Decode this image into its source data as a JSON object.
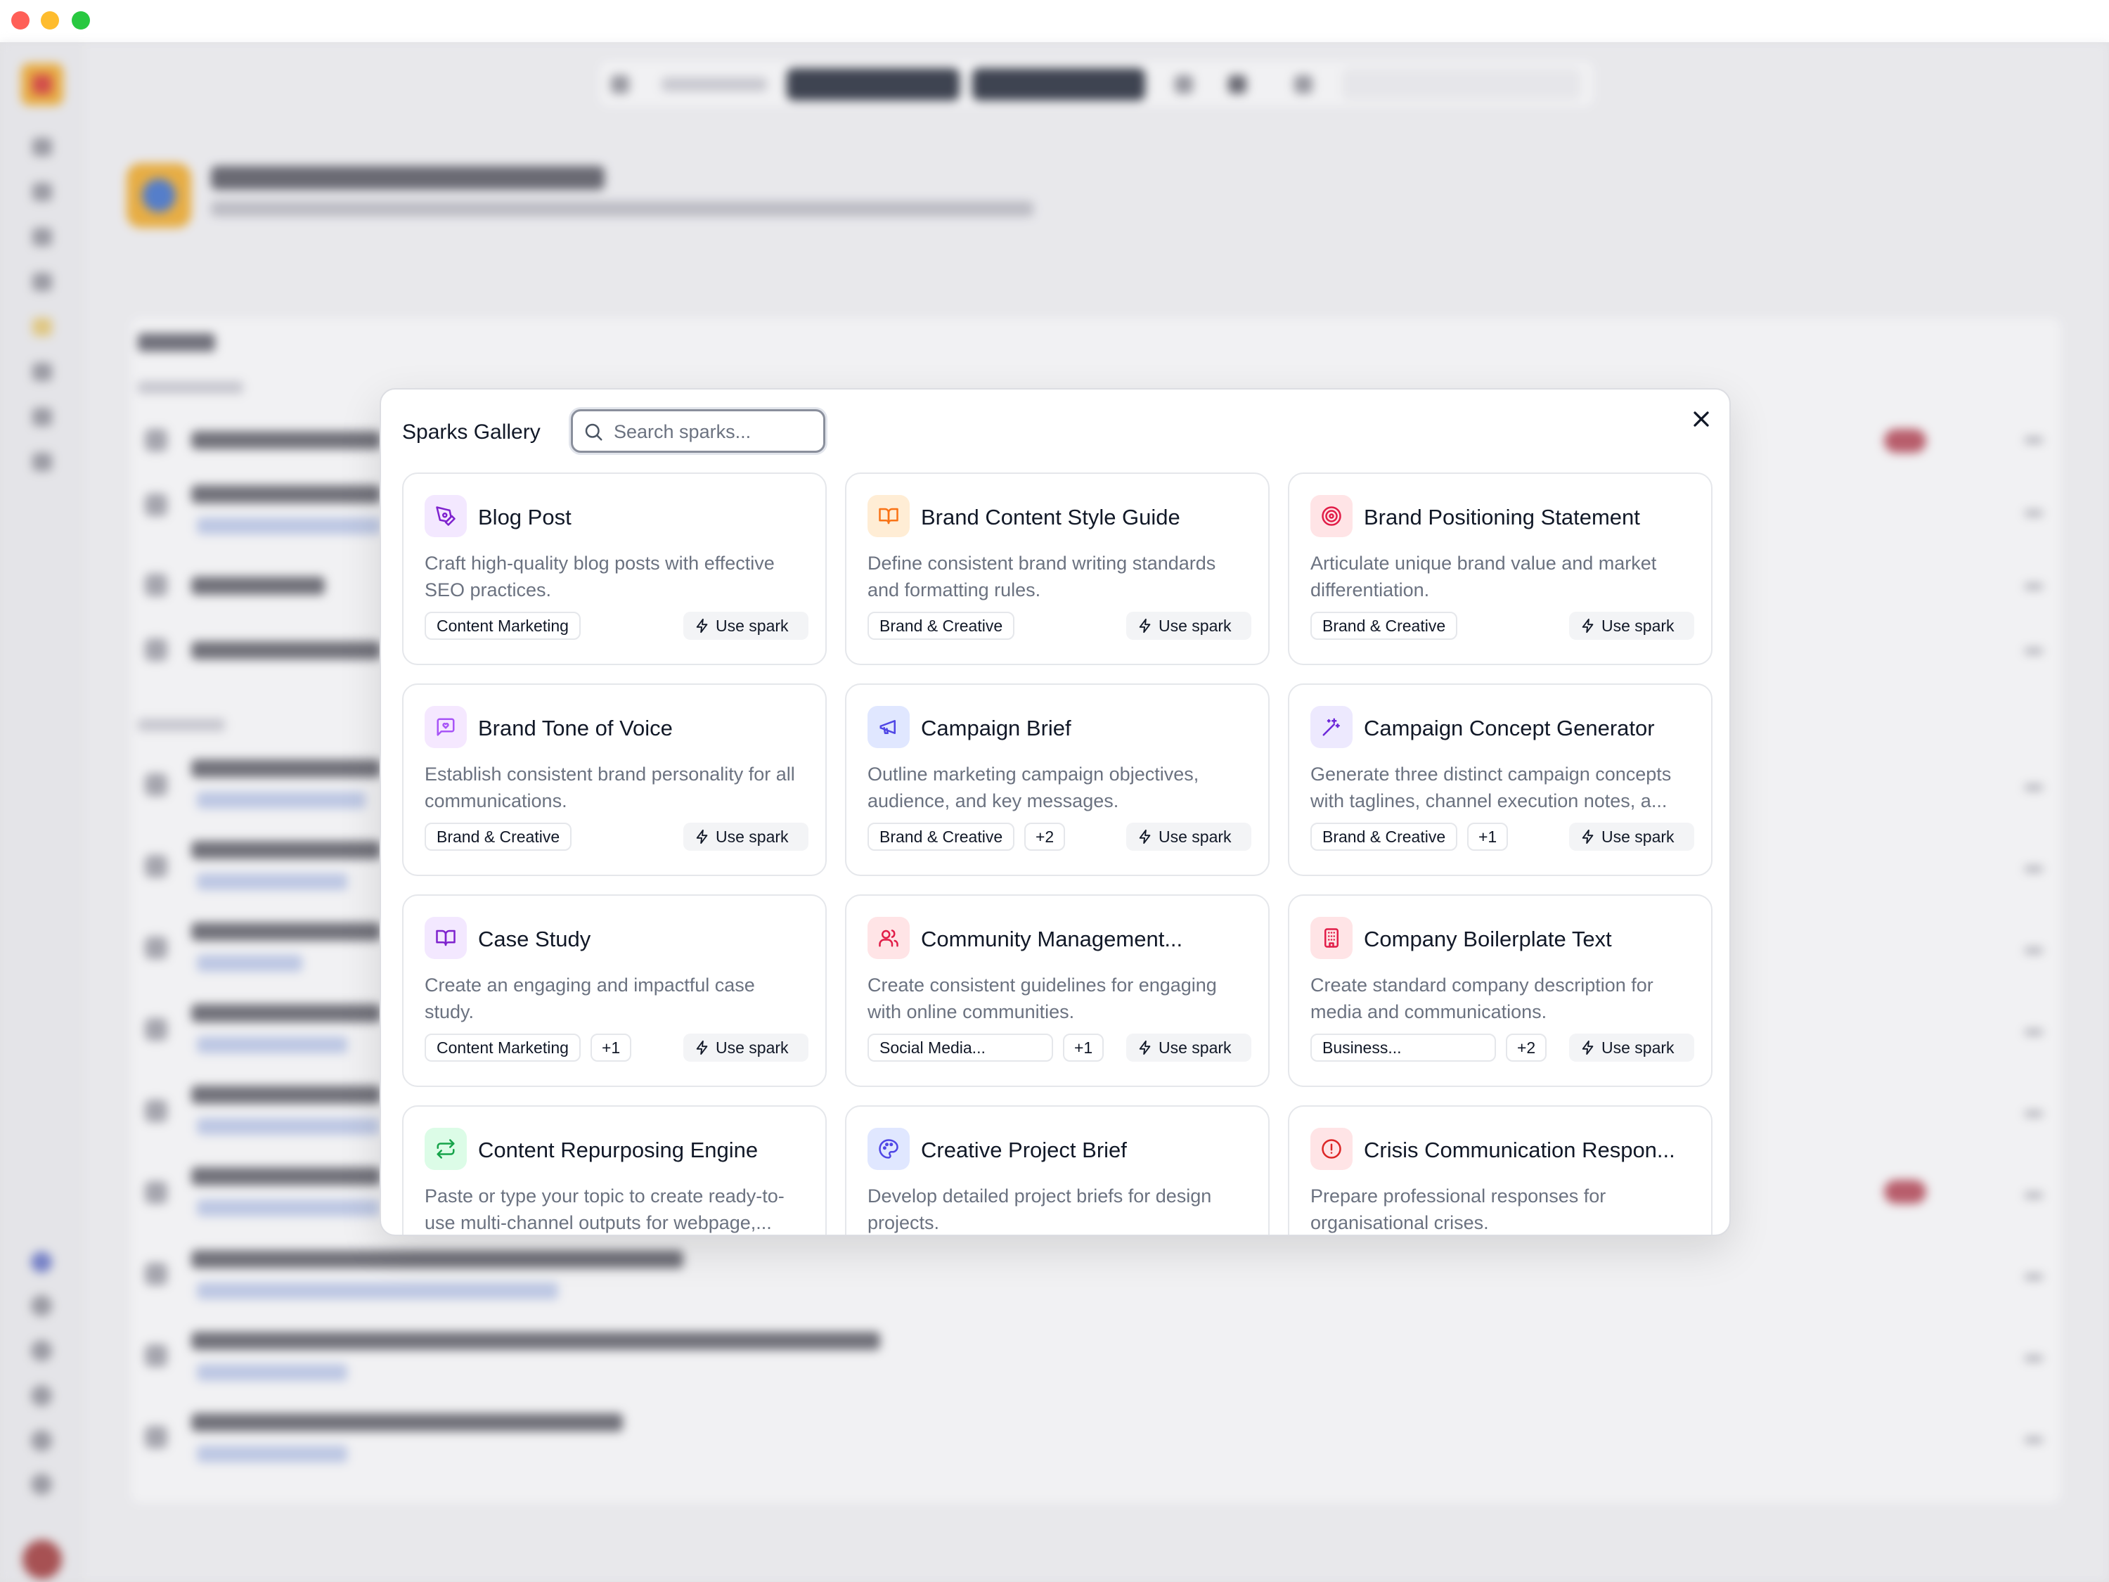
{
  "window": {
    "traffic_lights": [
      "#ff5f57",
      "#febc2e",
      "#28c840"
    ]
  },
  "modal": {
    "title": "Sparks Gallery",
    "search_placeholder": "Search sparks...",
    "close_icon": "close-icon"
  },
  "cards": [
    {
      "title": "Blog Post",
      "description": "Craft high-quality blog posts with effective SEO practices.",
      "tag": "Content Marketing",
      "more": "",
      "action": "Use spark",
      "icon": "pen-tool-icon",
      "icon_bg": "#f3e8ff",
      "icon_color": "#7e22ce"
    },
    {
      "title": "Brand Content Style Guide",
      "description": "Define consistent brand writing standards and formatting rules.",
      "tag": "Brand & Creative",
      "more": "",
      "action": "Use spark",
      "icon": "book-open-icon",
      "icon_bg": "#ffedd5",
      "icon_color": "#f97316"
    },
    {
      "title": "Brand Positioning Statement",
      "description": "Articulate unique brand value and market differentiation.",
      "tag": "Brand & Creative",
      "more": "",
      "action": "Use spark",
      "icon": "target-icon",
      "icon_bg": "#ffe4e6",
      "icon_color": "#e11d48"
    },
    {
      "title": "Brand Tone of Voice",
      "description": "Establish consistent brand personality for all communications.",
      "tag": "Brand & Creative",
      "more": "",
      "action": "Use spark",
      "icon": "message-heart-icon",
      "icon_bg": "#f5e8ff",
      "icon_color": "#a855f7"
    },
    {
      "title": "Campaign Brief",
      "description": "Outline marketing campaign objectives, audience, and key messages.",
      "tag": "Brand & Creative",
      "more": "+2",
      "action": "Use spark",
      "icon": "megaphone-icon",
      "icon_bg": "#e0e7ff",
      "icon_color": "#4f46e5"
    },
    {
      "title": "Campaign Concept Generator",
      "description": "Generate three distinct campaign concepts with taglines, channel execution notes, a...",
      "tag": "Brand & Creative",
      "more": "+1",
      "action": "Use spark",
      "icon": "wand-sparkles-icon",
      "icon_bg": "#ede9fe",
      "icon_color": "#6d28d9"
    },
    {
      "title": "Case Study",
      "description": "Create an engaging and impactful case study.",
      "tag": "Content Marketing",
      "more": "+1",
      "action": "Use spark",
      "icon": "book-open-icon",
      "icon_bg": "#f3e8ff",
      "icon_color": "#7e22ce"
    },
    {
      "title": "Community Management...",
      "description": "Create consistent guidelines for engaging with online communities.",
      "tag": "Social Media...",
      "more": "+1",
      "action": "Use spark",
      "icon": "users-icon",
      "icon_bg": "#ffe4e6",
      "icon_color": "#e11d48"
    },
    {
      "title": "Company Boilerplate Text",
      "description": "Create standard company description for media and communications.",
      "tag": "Business...",
      "more": "+2",
      "action": "Use spark",
      "icon": "building-icon",
      "icon_bg": "#ffe4e6",
      "icon_color": "#e11d48"
    },
    {
      "title": "Content Repurposing Engine",
      "description": "Paste or type your topic to create ready-to-use multi-channel outputs for webpage,...",
      "tag": "",
      "more": "",
      "action": "",
      "icon": "repeat-icon",
      "icon_bg": "#dcfce7",
      "icon_color": "#16a34a"
    },
    {
      "title": "Creative Project Brief",
      "description": "Develop detailed project briefs for design projects.",
      "tag": "",
      "more": "",
      "action": "",
      "icon": "palette-icon",
      "icon_bg": "#e0e7ff",
      "icon_color": "#4f46e5"
    },
    {
      "title": "Crisis Communication Respon...",
      "description": "Prepare professional responses for organisational crises.",
      "tag": "",
      "more": "",
      "action": "",
      "icon": "alert-circle-icon",
      "icon_bg": "#ffe4e6",
      "icon_color": "#dc2626"
    }
  ]
}
